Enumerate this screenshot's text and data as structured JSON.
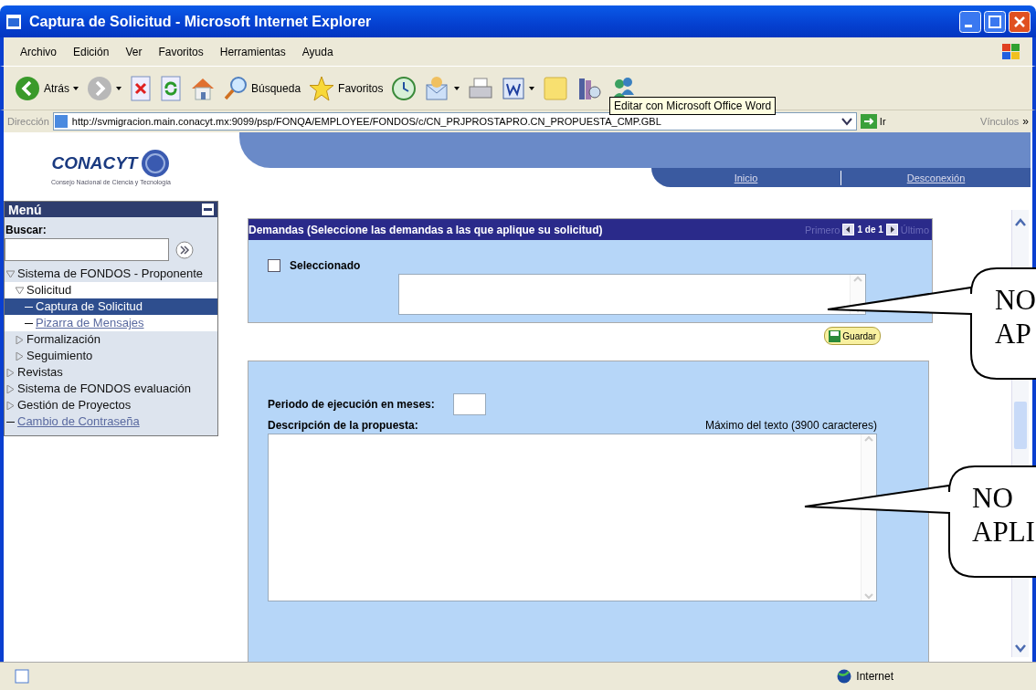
{
  "window": {
    "title": "Captura de Solicitud - Microsoft Internet Explorer"
  },
  "menu_bar": [
    "Archivo",
    "Edición",
    "Ver",
    "Favoritos",
    "Herramientas",
    "Ayuda"
  ],
  "toolbar": [
    {
      "kind": "back",
      "label": "Atrás",
      "dropdown": true
    },
    {
      "kind": "forward",
      "dropdown": true
    },
    {
      "kind": "stop"
    },
    {
      "kind": "refresh"
    },
    {
      "kind": "home"
    },
    {
      "kind": "search",
      "label": "Búsqueda"
    },
    {
      "kind": "favorites",
      "label": "Favoritos"
    },
    {
      "kind": "history"
    },
    {
      "kind": "mail",
      "dropdown": true
    },
    {
      "kind": "print"
    },
    {
      "kind": "word",
      "dropdown": true
    },
    {
      "kind": "note"
    },
    {
      "kind": "research"
    },
    {
      "kind": "messenger"
    }
  ],
  "tooltip": "Editar con Microsoft Office Word",
  "address_bar": {
    "label": "Dirección",
    "url": "http://svmigracion.main.conacyt.mx:9099/psp/FONQA/EMPLOYEE/FONDOS/c/CN_PRJPROSTAPRO.CN_PROPUESTA_CMP.GBL",
    "go": "Ir",
    "links": "Vínculos",
    "more": "»"
  },
  "header": {
    "logo": "CONACYT",
    "logo_subtitle": "Consejo Nacional de Ciencia y Tecnología",
    "nav": [
      "Inicio",
      "Desconexión"
    ]
  },
  "sidebar": {
    "title": "Menú",
    "search_label": "Buscar:",
    "items": [
      {
        "label": "Sistema de FONDOS - Proponente",
        "kind": "folder",
        "expanded": true,
        "selected": false,
        "children": [
          {
            "label": "Solicitud",
            "kind": "folder",
            "expanded": true,
            "selected": false,
            "children": [
              {
                "label": "Captura de Solicitud",
                "kind": "link",
                "selected": true
              },
              {
                "label": "Pizarra de Mensajes",
                "kind": "link",
                "selected": false
              }
            ]
          },
          {
            "label": "Formalización",
            "kind": "folder",
            "expanded": false,
            "selected": false
          },
          {
            "label": "Seguimiento",
            "kind": "folder",
            "expanded": false,
            "selected": false
          }
        ]
      },
      {
        "label": "Revistas",
        "kind": "folder",
        "expanded": false,
        "selected": false
      },
      {
        "label": "Sistema de FONDOS evaluación",
        "kind": "folder",
        "expanded": false,
        "selected": false
      },
      {
        "label": "Gestión de Proyectos",
        "kind": "folder",
        "expanded": false,
        "selected": false
      },
      {
        "label": "Cambio de Contraseña",
        "kind": "link",
        "selected": false
      }
    ]
  },
  "demands": {
    "title": "Demandas (Seleccione las demandas a las que aplique su solicitud)",
    "pager": {
      "first": "Primero",
      "count": "1 de 1",
      "last": "Último"
    },
    "checkbox": {
      "label": "Seleccionado",
      "checked": false
    },
    "save": "Guardar"
  },
  "proposal": {
    "period_label": "Periodo de ejecución en meses:",
    "description_label": "Descripción de la propuesta:",
    "max_note": "Máximo del texto (3900 caracteres)"
  },
  "callouts": [
    "NO AP",
    "NO APLI"
  ],
  "status_bar": {
    "zone": "Internet"
  }
}
